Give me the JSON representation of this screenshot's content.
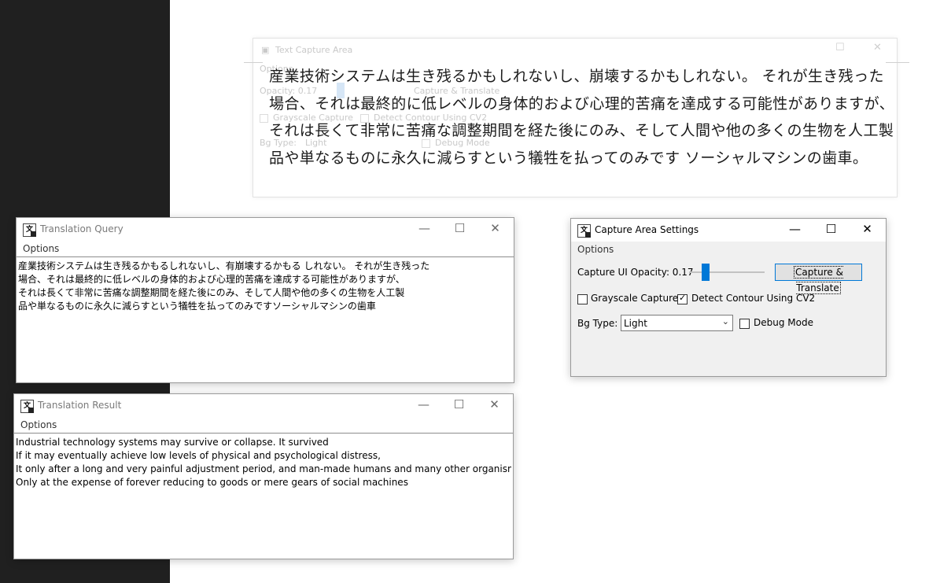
{
  "capture_area": {
    "title": "Text Capture Area",
    "options": "Options",
    "opacity_label": "Opacity: 0.17",
    "capture_btn": "Capture & Translate",
    "grayscale": "Grayscale Capture",
    "contour": "Detect Contour Using CV2",
    "bg_type": "Bg Type:",
    "bg_value": "Light",
    "debug": "Debug Mode",
    "lines": [
      "産業技術システムは生き残るかもしれないし、崩壊するかもしれない。 それが生き残った",
      "場合、それは最終的に低レベルの身体的および心理的苦痛を達成する可能性がありますが、",
      "それは長くて非常に苦痛な調整期間を経た後にのみ、そして人間や他の多くの生物を人工製",
      "品や単なるものに永久に減らすという犠牲を払ってのみです ソーシャルマシンの歯車。"
    ]
  },
  "query_window": {
    "title": "Translation Query",
    "menu": "Options",
    "lines": [
      "産業技術システムは生き残るかもるしれないし、有崩壊するかもる しれない。 それが生き残った",
      "場合、それは最終的に低レベルの身体的および心理的苦痛を達成する可能性がありますが、",
      "それは長くて非常に苦痛な調整期間を経た後にのみ、そして人間や他の多くの生物を人工製",
      "品や単なるものに永久に減らすという犠牲を払ってのみですソーシャルマシンの歯車"
    ]
  },
  "result_window": {
    "title": "Translation Result",
    "menu": "Options",
    "lines": [
      "Industrial technology systems may survive or collapse. It survived",
      "If it may eventually achieve low levels of physical and psychological distress,",
      "It only after a long and very painful adjustment period, and man-made humans and many other organisms",
      "Only at the expense of forever reducing to goods or mere gears of social machines"
    ]
  },
  "settings_window": {
    "title": "Capture Area Settings",
    "menu": "Options",
    "opacity_label": "Capture UI Opacity: 0.17",
    "opacity_value": 0.17,
    "capture_btn": "Capture & Translate",
    "grayscale_label": "Grayscale Capture",
    "grayscale_checked": false,
    "contour_label": "Detect Contour Using CV2",
    "contour_checked": true,
    "bg_label": "Bg Type:",
    "bg_value": "Light",
    "debug_label": "Debug Mode",
    "debug_checked": false
  },
  "window_controls": {
    "minimize": "—",
    "maximize": "☐",
    "close": "✕"
  },
  "colors": {
    "accent": "#0078d7",
    "dark_bg": "#202020"
  }
}
